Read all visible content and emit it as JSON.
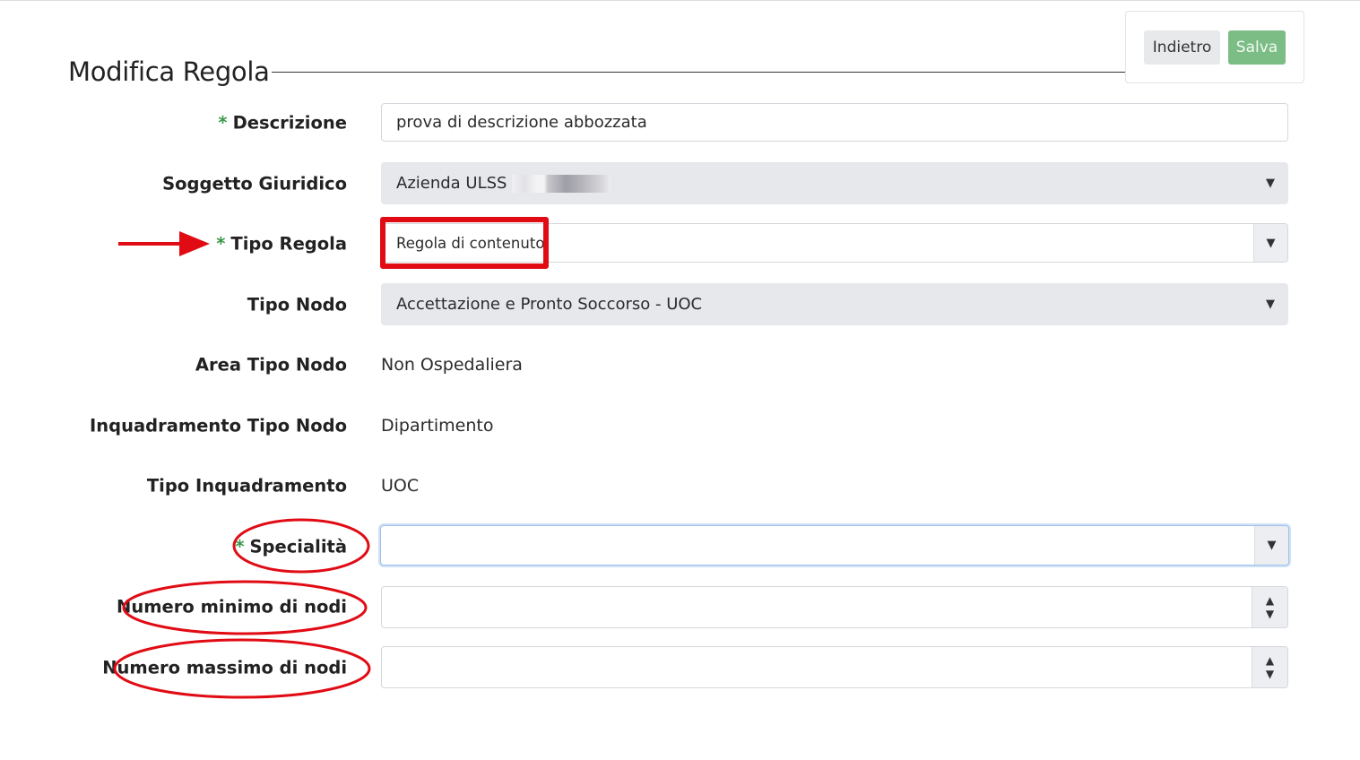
{
  "page": {
    "title": "Modifica Regola"
  },
  "toolbar": {
    "back_label": "Indietro",
    "save_label": "Salva"
  },
  "form": {
    "required_mark": "*",
    "descrizione": {
      "label": "Descrizione",
      "value": "prova di descrizione abbozzata"
    },
    "soggetto_giuridico": {
      "label": "Soggetto Giuridico",
      "value": "Azienda ULSS"
    },
    "tipo_regola": {
      "label": "Tipo Regola",
      "value": "Regola di contenuto"
    },
    "tipo_nodo": {
      "label": "Tipo Nodo",
      "value": "Accettazione e Pronto Soccorso - UOC"
    },
    "area_tipo_nodo": {
      "label": "Area Tipo Nodo",
      "value": "Non Ospedaliera"
    },
    "inquadramento_tipo_nodo": {
      "label": "Inquadramento Tipo Nodo",
      "value": "Dipartimento"
    },
    "tipo_inquadramento": {
      "label": "Tipo Inquadramento",
      "value": "UOC"
    },
    "specialita": {
      "label": "Specialità",
      "value": ""
    },
    "numero_minimo_nodi": {
      "label": "Numero minimo di nodi",
      "value": ""
    },
    "numero_massimo_nodi": {
      "label": "Numero massimo di nodi",
      "value": ""
    }
  },
  "icons": {
    "dropdown": "caret-down-icon",
    "spinner_up": "caret-up-icon",
    "spinner_down": "caret-down-icon",
    "dropdown_glyph": "▼",
    "spinner_up_glyph": "▲",
    "spinner_down_glyph": "▼"
  },
  "colors": {
    "required": "#3b9a48",
    "save_button": "#7cbc85",
    "annotation": "#e10b14"
  }
}
